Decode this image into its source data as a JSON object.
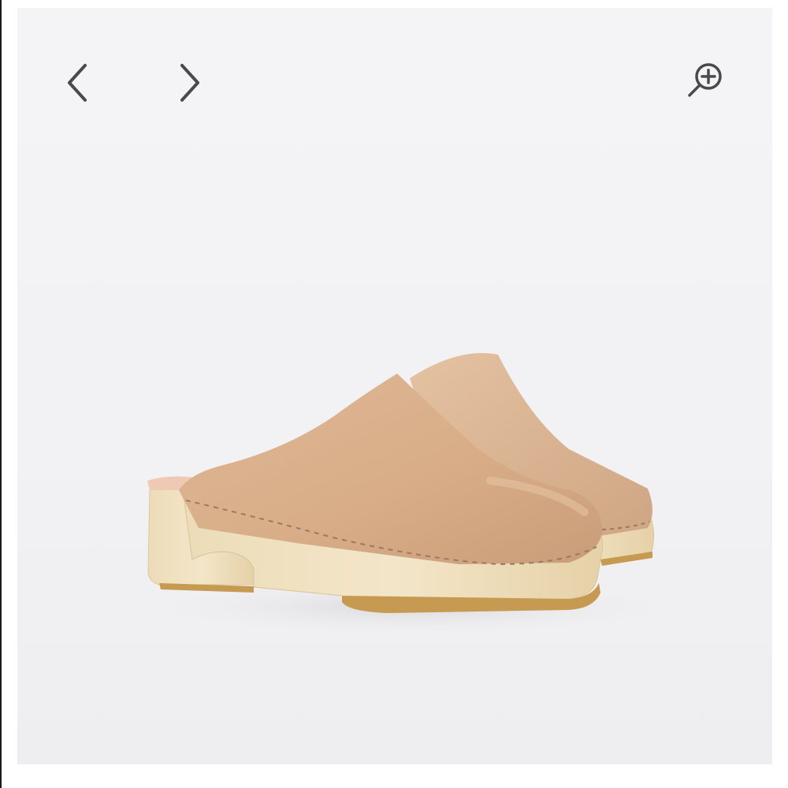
{
  "gallery": {
    "prev_icon": "chevron-left-icon",
    "next_icon": "chevron-right-icon",
    "zoom_icon": "zoom-in-icon",
    "photo_subject": "clog"
  },
  "colors": {
    "background": "#f2f2f4",
    "icon": "#4a4a4a",
    "leather": "#dcb28e",
    "wood": "#eddcb6"
  }
}
